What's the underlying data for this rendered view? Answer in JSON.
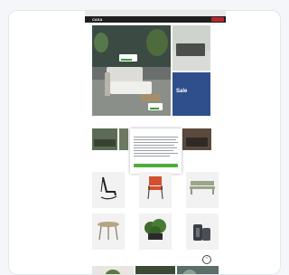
{
  "topbar": {
    "left": "",
    "right": ""
  },
  "header": {
    "logo": "CASA",
    "nav": [
      "",
      "",
      "",
      "",
      ""
    ]
  },
  "hero": {
    "tag1": "",
    "tag2": ""
  },
  "promo": {
    "line1": "",
    "line2": "Sale"
  },
  "sections": {
    "categories_heading": "",
    "products_heading": "",
    "bottom_heading": ""
  },
  "cookie_dialog": {
    "title": "",
    "accept_label": "",
    "settings_link": ""
  },
  "products": [
    {
      "name": ""
    },
    {
      "name": ""
    },
    {
      "name": ""
    },
    {
      "name": ""
    },
    {
      "name": ""
    },
    {
      "name": ""
    }
  ],
  "scroll_top_glyph": "⌃",
  "colors": {
    "header_bg": "#1f1f1f",
    "accent_red": "#b3282d",
    "promo_blue": "#2f4f8c",
    "cookie_accept_green": "#4caf3a"
  },
  "icons": [
    "scroll-to-top-icon"
  ]
}
